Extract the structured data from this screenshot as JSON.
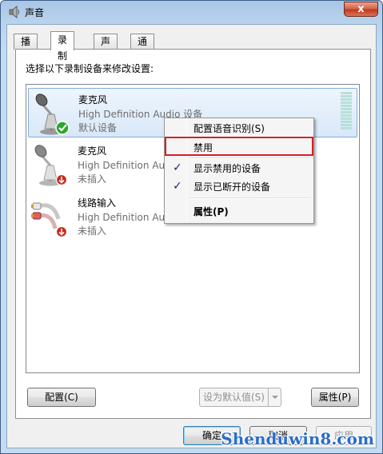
{
  "window": {
    "title": "声音",
    "close_glyph": "x"
  },
  "tabs": [
    {
      "label": "播放",
      "active": false
    },
    {
      "label": "录制",
      "active": true
    },
    {
      "label": "声音",
      "active": false
    },
    {
      "label": "通信",
      "active": false
    }
  ],
  "instruction": "选择以下录制设备来修改设置:",
  "devices": [
    {
      "name": "麦克风",
      "description": "High Definition Audio 设备",
      "status": "默认设备",
      "icon": "microphone-icon",
      "badge": "default-check-icon",
      "selected": true
    },
    {
      "name": "麦克风",
      "description": "High Definition Audio 设备",
      "status": "未插入",
      "icon": "microphone-icon",
      "badge": "unplugged-arrow-icon",
      "selected": false
    },
    {
      "name": "线路输入",
      "description": "High Definition Audio 设备",
      "status": "未插入",
      "icon": "line-in-jack-icon",
      "badge": "unplugged-arrow-icon",
      "selected": false
    }
  ],
  "context_menu": {
    "items": [
      {
        "label": "配置语音识别(S)",
        "checked": false,
        "bold": false
      },
      {
        "label": "禁用",
        "checked": false,
        "bold": false
      },
      {
        "label": "显示禁用的设备",
        "checked": true,
        "bold": false
      },
      {
        "label": "显示已断开的设备",
        "checked": true,
        "bold": false
      },
      {
        "label": "属性(P)",
        "checked": false,
        "bold": true
      }
    ],
    "check_glyph": "✓"
  },
  "buttons": {
    "configure": "配置(C)",
    "set_default": "设为默认值(S)",
    "properties": "属性(P)",
    "ok": "确定",
    "cancel": "取消",
    "apply": "应用"
  },
  "watermark": "Shenduwin8.com",
  "colors": {
    "selection_border": "#84acdd",
    "highlight_box": "#d62020",
    "check_mark": "#1a2a7a",
    "default_badge": "#2aa82a",
    "unplugged_badge": "#c8281e"
  }
}
